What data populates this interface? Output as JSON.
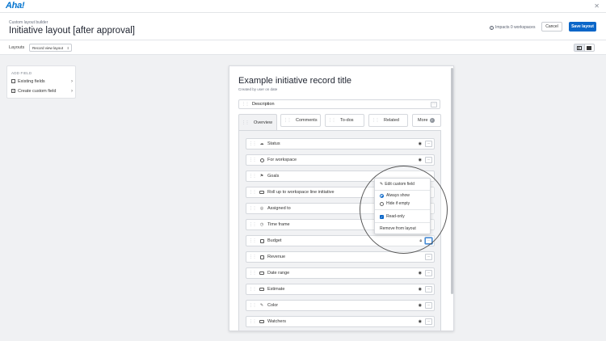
{
  "app": {
    "logo": "Aha!",
    "close_icon": "close-icon"
  },
  "header": {
    "eyebrow": "Custom layout builder",
    "title": "Initiative layout [after approval]",
    "impacts": "Impacts 0 workspaces",
    "cancel_label": "Cancel",
    "save_label": "Save layout"
  },
  "layouts_bar": {
    "label": "Layouts",
    "selected": "Record view layout"
  },
  "add_panel": {
    "heading": "ADD FIELD",
    "items": [
      {
        "label": "Existing fields",
        "icon": "checkbox-icon"
      },
      {
        "label": "Create custom field",
        "icon": "plus-box-icon"
      }
    ]
  },
  "record": {
    "title": "Example initiative record title",
    "subtitle": "Created by user on date",
    "description_label": "Description"
  },
  "tabs": [
    {
      "label": "Overview",
      "active": true
    },
    {
      "label": "Comments",
      "active": false
    },
    {
      "label": "To-dos",
      "active": false
    },
    {
      "label": "Related",
      "active": false
    },
    {
      "label": "More",
      "active": false,
      "badge": "2"
    }
  ],
  "fields": [
    {
      "label": "Status",
      "icon": "status-icon",
      "hidden_icon": true
    },
    {
      "label": "For workspace",
      "icon": "workspace-icon",
      "hidden_icon": true
    },
    {
      "label": "Goals",
      "icon": "flag-icon",
      "hidden_icon": false
    },
    {
      "label": "Roll up to workspace line initiative",
      "icon": "rollup-icon",
      "hidden_icon": false
    },
    {
      "label": "Assigned to",
      "icon": "eye-user-icon",
      "hidden_icon": false
    },
    {
      "label": "Time frame",
      "icon": "clock-icon",
      "hidden_icon": false
    },
    {
      "label": "Budget",
      "icon": "calendar-icon",
      "lock_icon": true
    },
    {
      "label": "Revenue",
      "icon": "calendar-icon",
      "hidden_icon": false
    },
    {
      "label": "Date range",
      "icon": "field-icon",
      "hidden_icon": true
    },
    {
      "label": "Estimate",
      "icon": "field-icon",
      "hidden_icon": true
    },
    {
      "label": "Color",
      "icon": "eyedropper-icon",
      "hidden_icon": true
    },
    {
      "label": "Watchers",
      "icon": "field-icon",
      "hidden_icon": true
    }
  ],
  "context_menu": {
    "edit_label": "Edit custom field",
    "always_show": "Always show",
    "hide_if_empty": "Hide if empty",
    "read_only": "Read-only",
    "remove_label": "Remove from layout",
    "selected_visibility": "Always show",
    "read_only_checked": true
  },
  "colors": {
    "accent": "#0a66c8",
    "logo": "#0073cf",
    "background": "#f0f1f3"
  }
}
